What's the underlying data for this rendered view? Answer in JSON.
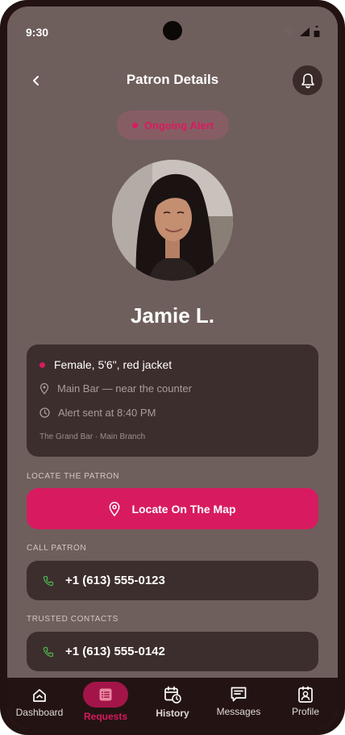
{
  "status_bar": {
    "time": "9:30"
  },
  "header": {
    "title": "Patron Details"
  },
  "alert_status": {
    "label": "Ongoing Alert",
    "color": "#d81b60"
  },
  "patron": {
    "name": "Jamie L.",
    "description": "Female, 5'6\", red jacket",
    "location": "Main Bar — near the counter",
    "alert_time": "Alert sent at 8:40 PM",
    "venue": "The Grand Bar · Main Branch"
  },
  "locate": {
    "section_label": "LOCATE THE PATRON",
    "button_label": "Locate On The Map"
  },
  "call": {
    "section_label": "CALL PATRON",
    "phone": "+1 (613) 555-0123"
  },
  "trusted": {
    "section_label": "TRUSTED CONTACTS",
    "phone": "+1 (613) 555-0142"
  },
  "nav": {
    "items": [
      {
        "label": "Dashboard",
        "icon": "home-icon",
        "active": false
      },
      {
        "label": "Requests",
        "icon": "list-icon",
        "active": true
      },
      {
        "label": "History",
        "icon": "calendar-clock-icon",
        "active": false
      },
      {
        "label": "Messages",
        "icon": "chat-icon",
        "active": false
      },
      {
        "label": "Profile",
        "icon": "profile-card-icon",
        "active": false
      }
    ]
  },
  "colors": {
    "accent": "#d81b60",
    "background": "#6f5f5c",
    "card": "#3c2e2c",
    "nav_background": "#231413",
    "phone_icon": "#4caf50"
  }
}
